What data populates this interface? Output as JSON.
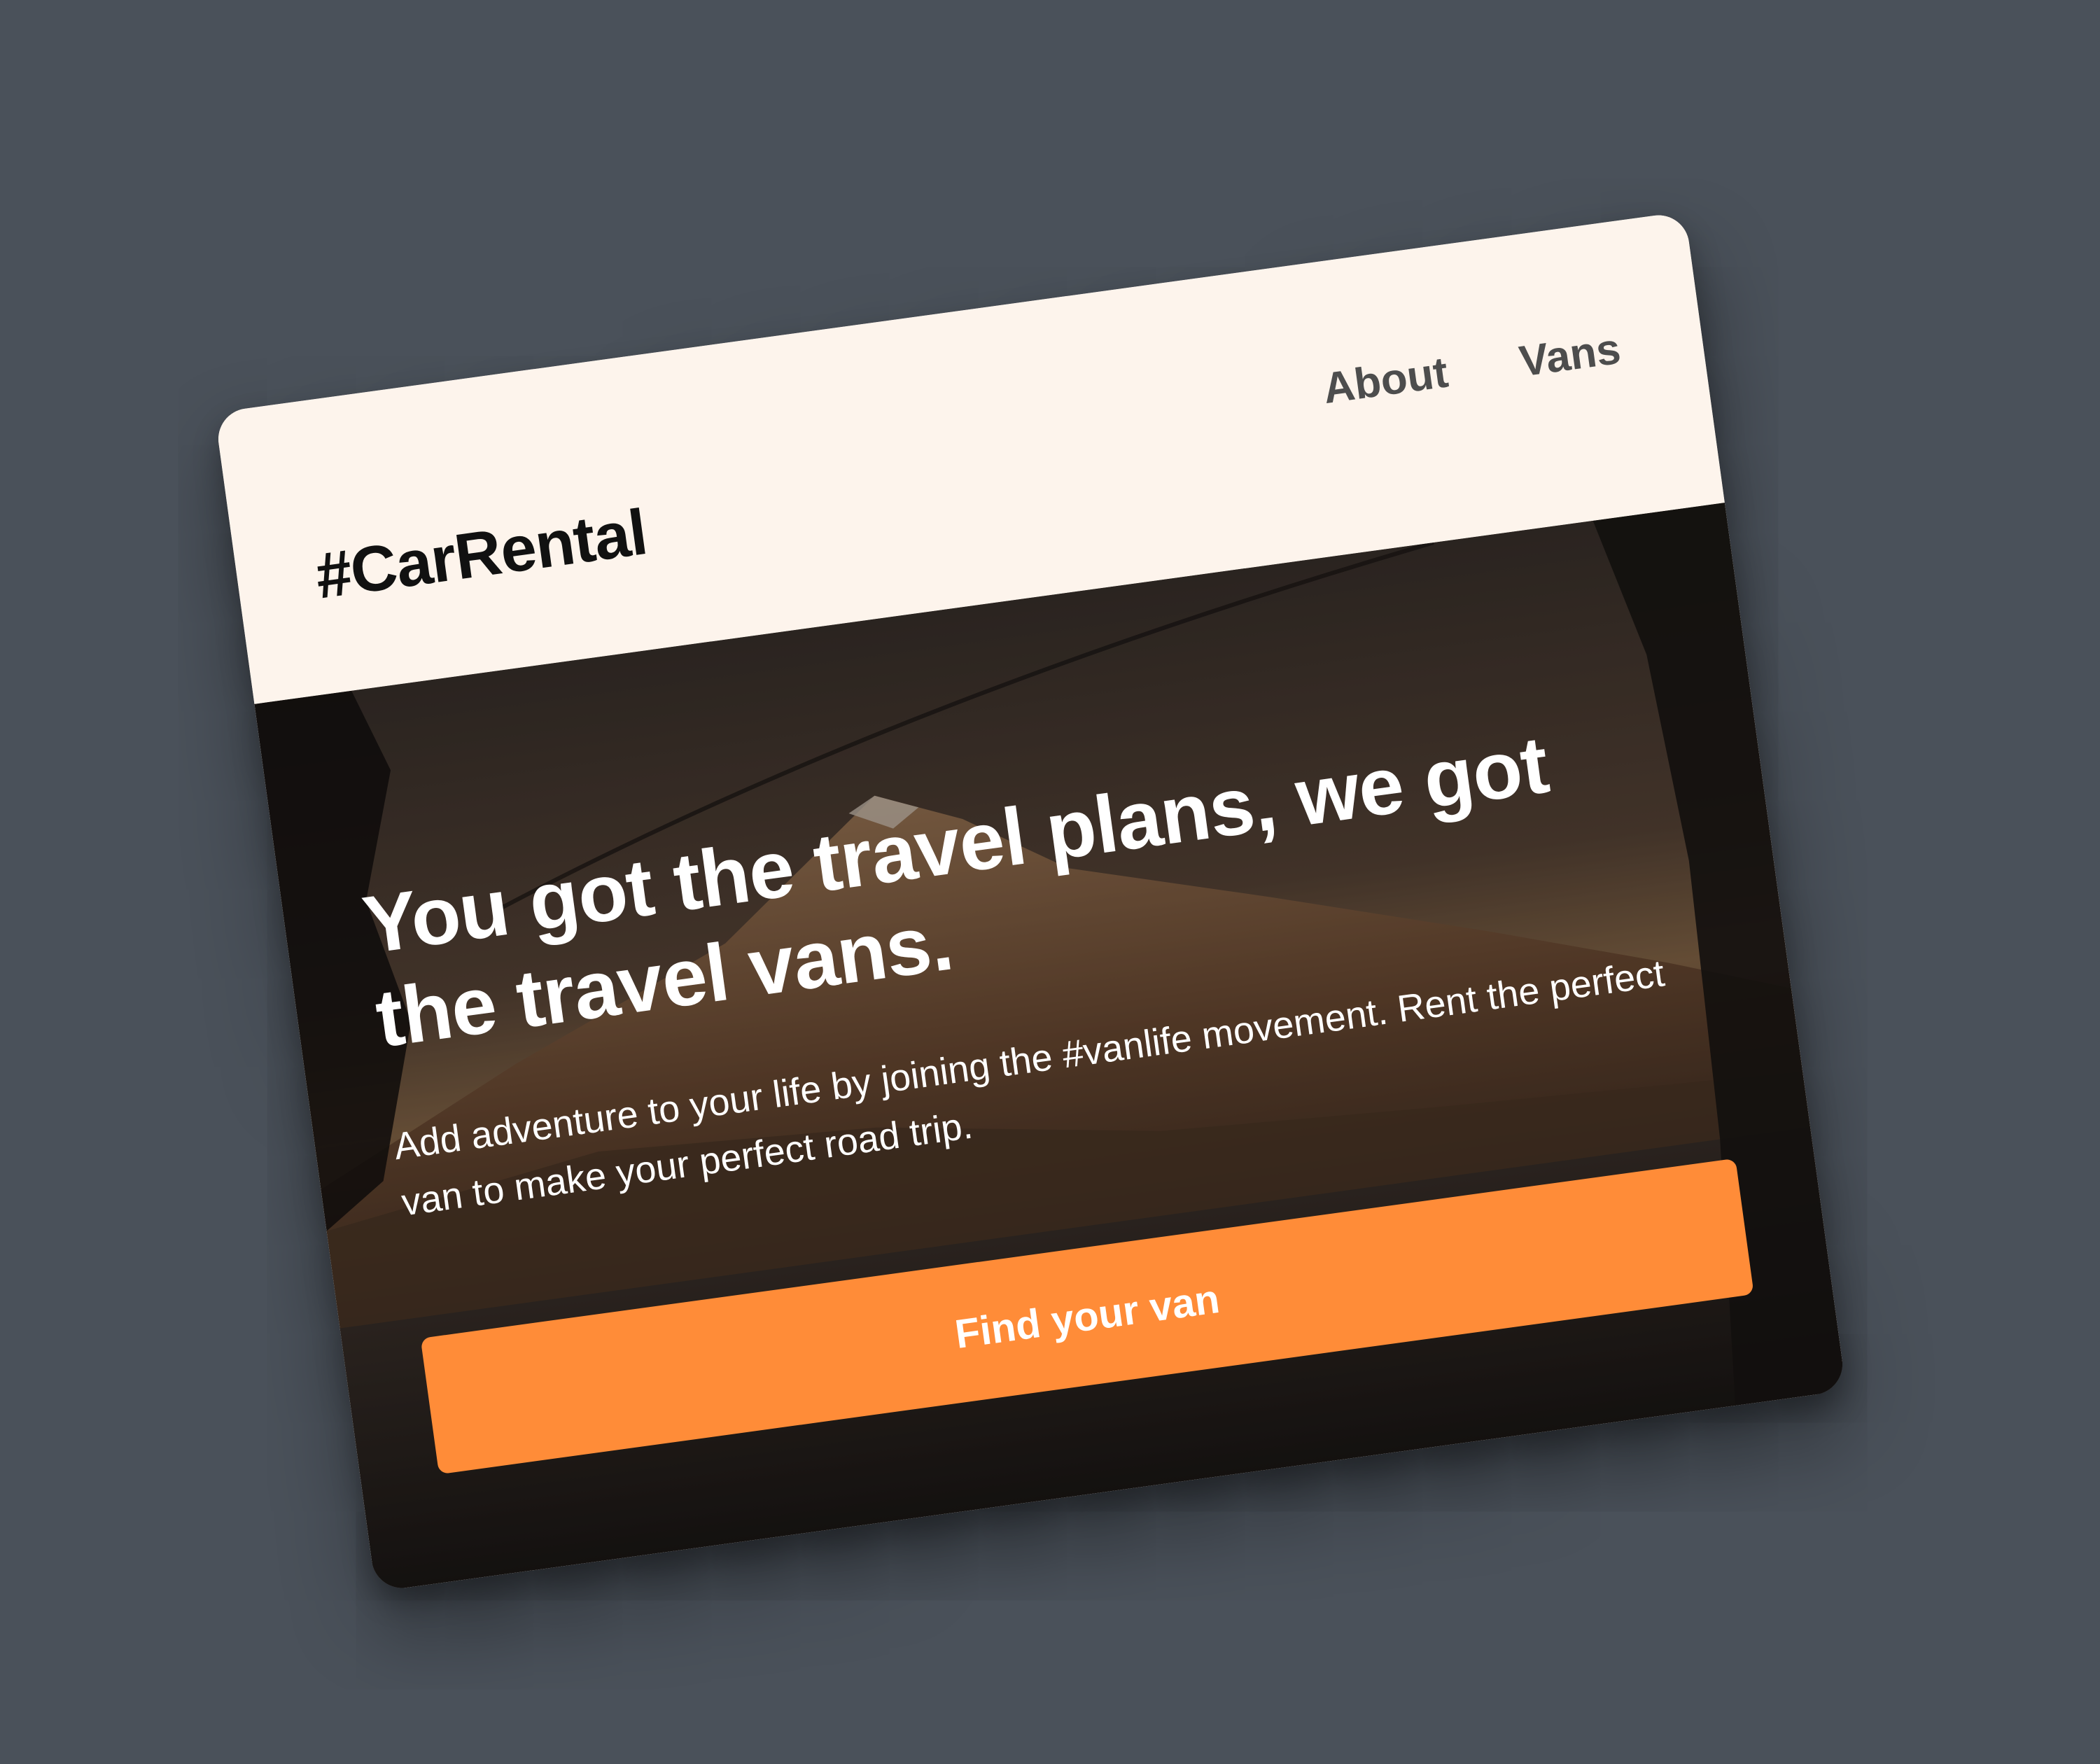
{
  "brand": {
    "logo_text": "#CarRental"
  },
  "nav": {
    "items": [
      {
        "label": "About"
      },
      {
        "label": "Vans"
      }
    ]
  },
  "hero": {
    "headline": "You got the travel plans, we got the travel vans.",
    "subtext": "Add adventure to your life by joining the #vanlife movement. Rent the perfect van to make your perfect road trip.",
    "cta_label": "Find your van"
  },
  "colors": {
    "page_background": "#4a515a",
    "header_background": "#fdf4ec",
    "accent": "#ff8c38",
    "nav_text": "#4d4d4d"
  }
}
